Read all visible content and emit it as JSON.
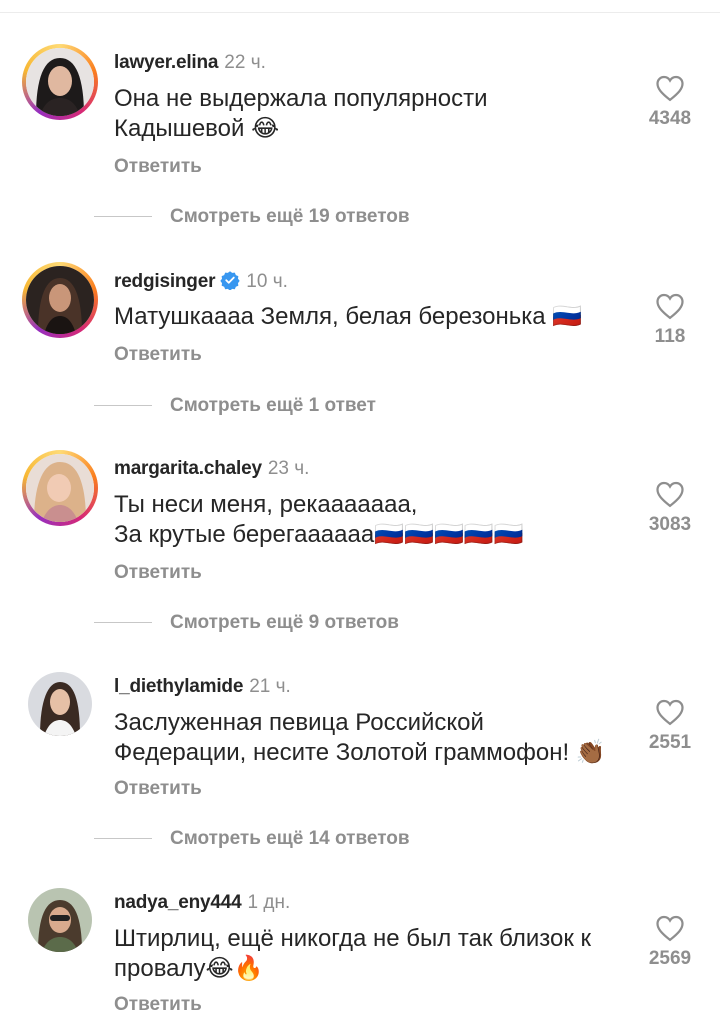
{
  "comments": [
    {
      "username": "lawyer.elina",
      "verified": false,
      "time": "22 ч.",
      "text_lines": [
        "Она не выдержала популярности",
        "Кадышевой 😂"
      ],
      "reply_label": "Ответить",
      "likes": "4348",
      "more_replies": "Смотреть ещё 19 ответов"
    },
    {
      "username": "redgisinger",
      "verified": true,
      "time": "10 ч.",
      "text_lines": [
        "Матушкаааа Земля, белая березонька 🇷🇺"
      ],
      "reply_label": "Ответить",
      "likes": "118",
      "more_replies": "Смотреть ещё 1 ответ"
    },
    {
      "username": "margarita.chaley",
      "verified": false,
      "time": "23 ч.",
      "text_lines": [
        "Ты неси меня, рекааааааа,",
        "За крутые берегаааааа🇷🇺🇷🇺🇷🇺🇷🇺🇷🇺"
      ],
      "reply_label": "Ответить",
      "likes": "3083",
      "more_replies": "Смотреть ещё 9 ответов"
    },
    {
      "username": "l_diethylamide",
      "verified": false,
      "time": "21 ч.",
      "text_lines": [
        "Заслуженная певица Российской",
        "Федерации, несите Золотой граммофон! 👏🏾"
      ],
      "reply_label": "Ответить",
      "likes": "2551",
      "more_replies": "Смотреть ещё 14 ответов"
    },
    {
      "username": "nadya_eny444",
      "verified": false,
      "time": "1 дн.",
      "text_lines": [
        "Штирлиц, ещё никогда не был так близок к",
        "провалу😂🔥"
      ],
      "reply_label": "Ответить",
      "likes": "2569"
    }
  ],
  "icons": {
    "heart": "heart-outline-icon",
    "verified": "verified-badge-icon",
    "laugh": "tears-of-joy-emoji",
    "flag": "russia-flag-emoji",
    "clap": "clapping-hands-emoji",
    "fire": "fire-emoji"
  },
  "colors": {
    "username": "#262626",
    "secondary": "#8e8e8e",
    "verified": "#3897f0",
    "story_ring": "#d62976"
  }
}
